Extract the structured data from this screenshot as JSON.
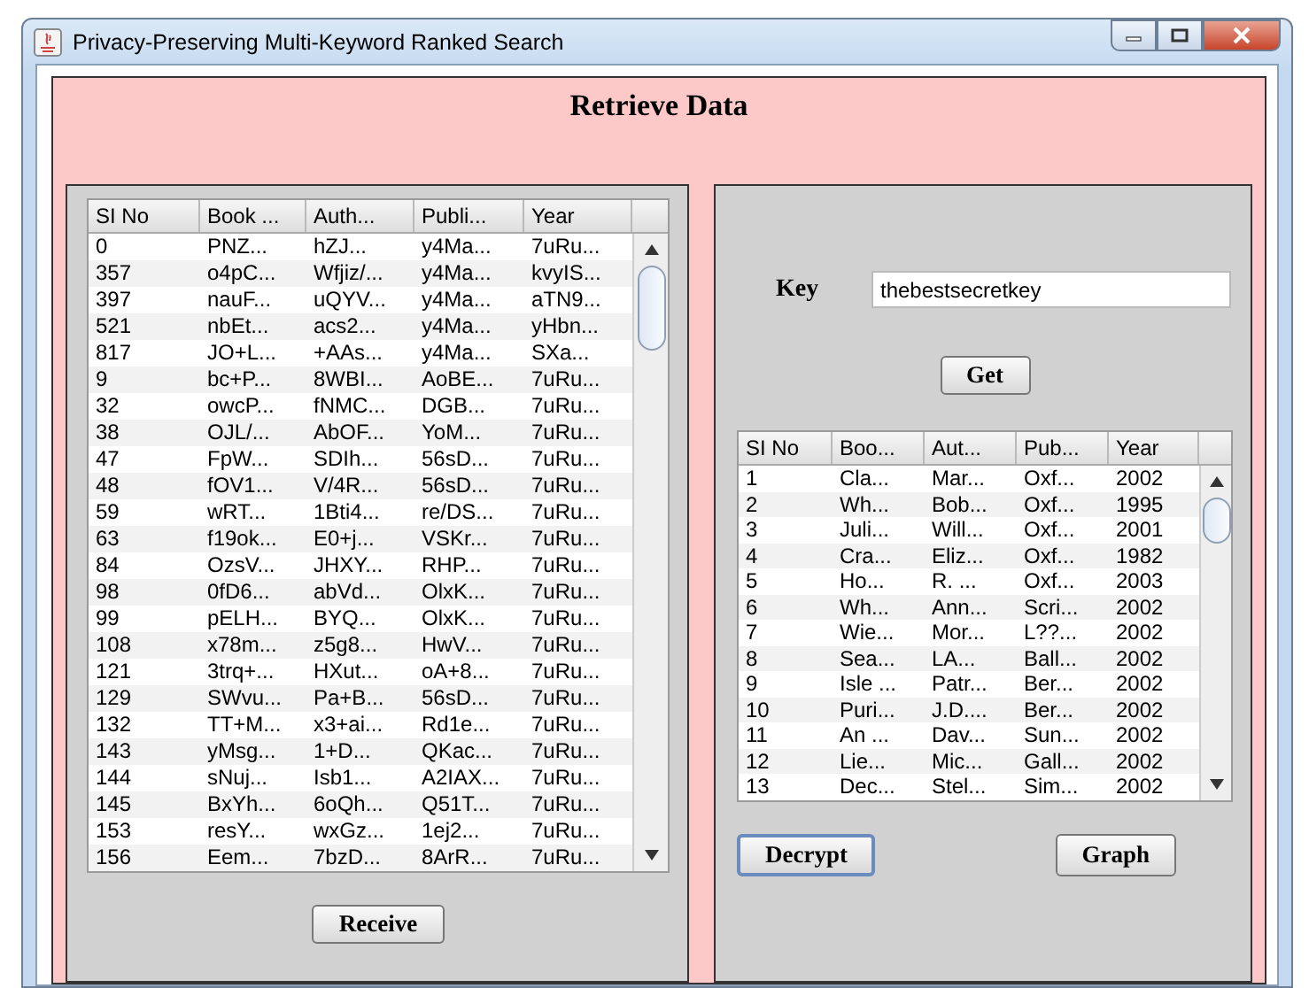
{
  "window": {
    "title": "Privacy-Preserving Multi-Keyword Ranked Search"
  },
  "heading": "Retrieve Data",
  "left_table": {
    "columns": [
      "SI No",
      "Book ...",
      "Auth...",
      "Publi...",
      "Year"
    ],
    "rows": [
      [
        "0",
        "PNZ...",
        "hZJ...",
        "y4Ma...",
        "7uRu..."
      ],
      [
        "357",
        "o4pC...",
        "Wfjiz/...",
        "y4Ma...",
        "kvyIS..."
      ],
      [
        "397",
        "nauF...",
        "uQYV...",
        "y4Ma...",
        "aTN9..."
      ],
      [
        "521",
        "nbEt...",
        "acs2...",
        "y4Ma...",
        "yHbn..."
      ],
      [
        "817",
        "JO+L...",
        "+AAs...",
        "y4Ma...",
        "SXa..."
      ],
      [
        "9",
        "bc+P...",
        "8WBI...",
        "AoBE...",
        "7uRu..."
      ],
      [
        "32",
        "owcP...",
        "fNMC...",
        "DGB...",
        "7uRu..."
      ],
      [
        "38",
        "OJL/...",
        "AbOF...",
        "YoM...",
        "7uRu..."
      ],
      [
        "47",
        "FpW...",
        "SDIh...",
        "56sD...",
        "7uRu..."
      ],
      [
        "48",
        "fOV1...",
        "V/4R...",
        "56sD...",
        "7uRu..."
      ],
      [
        "59",
        "wRT...",
        "1Bti4...",
        "re/DS...",
        "7uRu..."
      ],
      [
        "63",
        "f19ok...",
        "E0+j...",
        "VSKr...",
        "7uRu..."
      ],
      [
        "84",
        "OzsV...",
        "JHXY...",
        "RHP...",
        "7uRu..."
      ],
      [
        "98",
        "0fD6...",
        "abVd...",
        "OlxK...",
        "7uRu..."
      ],
      [
        "99",
        "pELH...",
        "BYQ...",
        "OlxK...",
        "7uRu..."
      ],
      [
        "108",
        "x78m...",
        "z5g8...",
        "HwV...",
        "7uRu..."
      ],
      [
        "121",
        "3trq+...",
        "HXut...",
        "oA+8...",
        "7uRu..."
      ],
      [
        "129",
        "SWvu...",
        "Pa+B...",
        "56sD...",
        "7uRu..."
      ],
      [
        "132",
        "TT+M...",
        "x3+ai...",
        "Rd1e...",
        "7uRu..."
      ],
      [
        "143",
        "yMsg...",
        "1+D...",
        "QKac...",
        "7uRu..."
      ],
      [
        "144",
        "sNuj...",
        "Isb1...",
        "A2IAX...",
        "7uRu..."
      ],
      [
        "145",
        "BxYh...",
        "6oQh...",
        "Q51T...",
        "7uRu..."
      ],
      [
        "153",
        "resY...",
        "wxGz...",
        "1ej2...",
        "7uRu..."
      ],
      [
        "156",
        "Eem...",
        "7bzD...",
        "8ArR...",
        "7uRu..."
      ]
    ]
  },
  "receive_button": "Receive",
  "key": {
    "label": "Key",
    "value": "thebestsecretkey"
  },
  "get_button": "Get",
  "right_table": {
    "columns": [
      "SI No",
      "Boo...",
      "Aut...",
      "Pub...",
      "Year"
    ],
    "rows": [
      [
        "1",
        "Cla...",
        "Mar...",
        "Oxf...",
        "2002"
      ],
      [
        "2",
        "Wh...",
        "Bob...",
        "Oxf...",
        "1995"
      ],
      [
        "3",
        "Juli...",
        "Will...",
        "Oxf...",
        "2001"
      ],
      [
        "4",
        "Cra...",
        "Eliz...",
        "Oxf...",
        "1982"
      ],
      [
        "5",
        "Ho...",
        "R. ...",
        "Oxf...",
        "2003"
      ],
      [
        "6",
        "Wh...",
        "Ann...",
        "Scri...",
        "2002"
      ],
      [
        "7",
        "Wie...",
        "Mor...",
        "L??...",
        "2002"
      ],
      [
        "8",
        "Sea...",
        "LA...",
        "Ball...",
        "2002"
      ],
      [
        "9",
        "Isle ...",
        "Patr...",
        "Ber...",
        "2002"
      ],
      [
        "10",
        "Puri...",
        "J.D....",
        "Ber...",
        "2002"
      ],
      [
        "11",
        "An ...",
        "Dav...",
        "Sun...",
        "2002"
      ],
      [
        "12",
        "Lie...",
        "Mic...",
        "Gall...",
        "2002"
      ],
      [
        "13",
        "Dec...",
        "Stel...",
        "Sim...",
        "2002"
      ]
    ]
  },
  "decrypt_button": "Decrypt",
  "graph_button": "Graph"
}
